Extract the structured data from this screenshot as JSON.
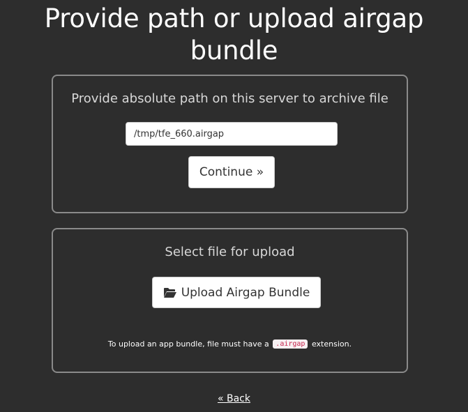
{
  "page": {
    "title": "Provide path or upload airgap bundle"
  },
  "path_panel": {
    "heading": "Provide absolute path on this server to archive file",
    "input_value": "/tmp/tfe_660.airgap",
    "continue_label": "Continue »"
  },
  "upload_panel": {
    "heading": "Select file for upload",
    "upload_label": "Upload Airgap Bundle",
    "upload_icon": "folder-open-icon",
    "note_prefix": "To upload an app bundle, file must have a",
    "note_code": ".airgap",
    "note_suffix": "extension."
  },
  "footer": {
    "back_label": "« Back"
  },
  "colors": {
    "background": "#2d2d2d",
    "panel_border": "#8a8a8a",
    "code_text": "#c7254e",
    "code_bg": "#f7f0f2"
  }
}
